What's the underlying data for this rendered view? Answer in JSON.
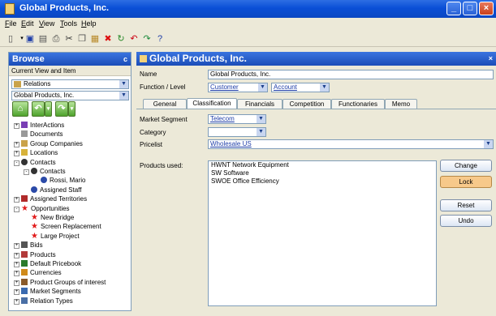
{
  "window": {
    "title": "Global Products, Inc."
  },
  "menu": [
    "File",
    "Edit",
    "View",
    "Tools",
    "Help"
  ],
  "left": {
    "title": "Browse",
    "pin": "c",
    "current_view_label": "Current View and Item",
    "view_select": "Relations",
    "item_select": "Global Products, Inc.",
    "tree": [
      {
        "label": "InterActions",
        "level": 0,
        "expander": "+",
        "icon": "interactions-icon"
      },
      {
        "label": "Documents",
        "level": 0,
        "expander": "",
        "icon": "documents-icon"
      },
      {
        "label": "Group Companies",
        "level": 0,
        "expander": "+",
        "icon": "group-companies-icon"
      },
      {
        "label": "Locations",
        "level": 0,
        "expander": "+",
        "icon": "locations-icon"
      },
      {
        "label": "Contacts",
        "level": 0,
        "expander": "-",
        "icon": "contacts-icon"
      },
      {
        "label": "Contacts",
        "level": 1,
        "expander": "-",
        "icon": "contacts-icon"
      },
      {
        "label": "Rossi, Mario",
        "level": 2,
        "expander": "",
        "icon": "person-icon"
      },
      {
        "label": "Assigned Staff",
        "level": 1,
        "expander": "",
        "icon": "person-icon"
      },
      {
        "label": "Assigned Territories",
        "level": 0,
        "expander": "+",
        "icon": "territories-icon"
      },
      {
        "label": "Opportunities",
        "level": 0,
        "expander": "-",
        "icon": "star-icon"
      },
      {
        "label": "New Bridge",
        "level": 1,
        "expander": "",
        "icon": "star-icon"
      },
      {
        "label": "Screen Replacement",
        "level": 1,
        "expander": "",
        "icon": "star-icon"
      },
      {
        "label": "Large Project",
        "level": 1,
        "expander": "",
        "icon": "star-icon"
      },
      {
        "label": "Bids",
        "level": 0,
        "expander": "+",
        "icon": "bids-icon"
      },
      {
        "label": "Products",
        "level": 0,
        "expander": "+",
        "icon": "products-icon"
      },
      {
        "label": "Default Pricebook",
        "level": 0,
        "expander": "+",
        "icon": "pricebook-icon"
      },
      {
        "label": "Currencies",
        "level": 0,
        "expander": "+",
        "icon": "currencies-icon"
      },
      {
        "label": "Product Groups of interest",
        "level": 0,
        "expander": "+",
        "icon": "product-groups-icon"
      },
      {
        "label": "Market Segments",
        "level": 0,
        "expander": "+",
        "icon": "market-segments-icon"
      },
      {
        "label": "Relation Types",
        "level": 0,
        "expander": "+",
        "icon": "relation-types-icon"
      }
    ]
  },
  "right": {
    "title": "Global Products, Inc.",
    "close": "×",
    "name_label": "Name",
    "name_value": "Global Products, Inc.",
    "function_label": "Function / Level",
    "function_value": "Customer",
    "level_value": "Account",
    "tabs": [
      "General",
      "Classification",
      "Financials",
      "Competition",
      "Functionaries",
      "Memo"
    ],
    "market_segment_label": "Market Segment",
    "market_segment_value": "Telecom",
    "category_label": "Category",
    "category_value": "",
    "pricelist_label": "Pricelist",
    "pricelist_value": "Wholesale US",
    "products_label": "Products used:",
    "products": [
      "HWNT Network Equipment",
      "SW Software",
      "SWOE Office Efficiency"
    ],
    "buttons": {
      "change": "Change",
      "lock": "Lock",
      "reset": "Reset",
      "undo": "Undo"
    }
  },
  "colors": {
    "accent": "#0a4fd6",
    "lock": "#f7c98a",
    "link": "#1f3ea8"
  }
}
